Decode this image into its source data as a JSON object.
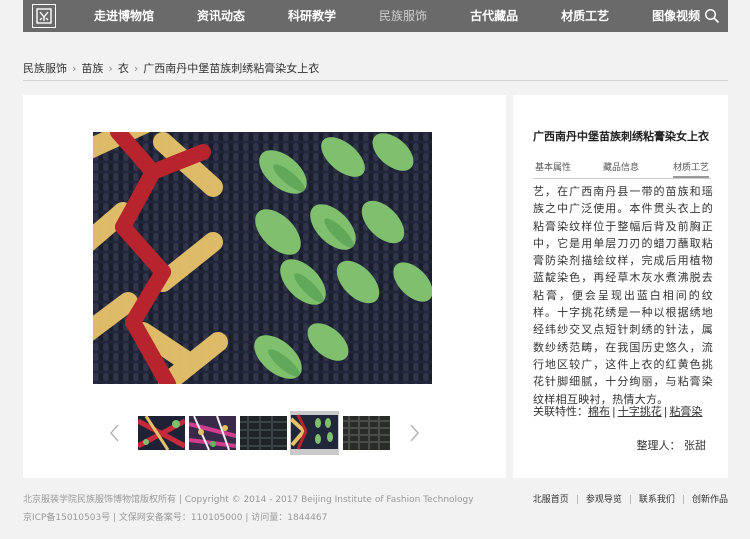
{
  "nav": {
    "logo_char": "苗",
    "items": [
      {
        "label": "走进博物馆",
        "active": false
      },
      {
        "label": "资讯动态",
        "active": false
      },
      {
        "label": "科研教学",
        "active": false
      },
      {
        "label": "民族服饰",
        "active": true
      },
      {
        "label": "古代藏品",
        "active": false
      },
      {
        "label": "材质工艺",
        "active": false
      },
      {
        "label": "图像视频",
        "active": false
      }
    ],
    "search_icon": "search-icon"
  },
  "breadcrumb": {
    "items": [
      "民族服饰",
      "苗族",
      "衣",
      "广西南丹中堡苗族刺绣粘膏染女上衣"
    ],
    "separator": "›"
  },
  "gallery": {
    "prev_icon": "chevron-left-icon",
    "next_icon": "chevron-right-icon",
    "selected_index": 3,
    "thumbnails": [
      "thumb-1",
      "thumb-2",
      "thumb-3",
      "thumb-4",
      "thumb-5"
    ]
  },
  "detail": {
    "title": "广西南丹中堡苗族刺绣粘膏染女上衣",
    "tabs": [
      {
        "label": "基本属性",
        "active": false
      },
      {
        "label": "藏品信息",
        "active": false
      },
      {
        "label": "材质工艺",
        "active": true
      }
    ],
    "description": "艺，在广西南丹县一带的苗族和瑶族之中广泛使用。本件贯头衣上的粘膏染纹样位于整幅后背及前胸正中，它是用单层刀刃的蜡刀蘸取粘膏防染剂描绘纹样，完成后用植物蓝靛染色，再经草木灰水煮沸脱去粘膏，便会呈现出蓝白相间的纹样。十字挑花绣是一种以根据绣地经纬纱交叉点短针刺绣的针法，属数纱绣范畴，在我国历史悠久，流行地区较广，这件上衣的红黄色挑花针脚细腻，十分绚丽，与粘膏染纹样相互映衬，热情大方。",
    "related_label": "关联特性：",
    "related_links": [
      "棉布",
      "十字挑花",
      "粘膏染"
    ],
    "related_sep": "|",
    "editor": "整理人：  张甜"
  },
  "footer": {
    "copyright": "北京服装学院民族服饰博物馆版权所有  |  Copyright © 2014 - 2017 Beijing Institute of Fashion Technology",
    "icp": "京ICP备15010503号  |  文保网安备案号：110105000  |  访问量：1844467",
    "links": [
      "北服首页",
      "参观导览",
      "联系我们",
      "创新作品"
    ],
    "link_sep": "|"
  }
}
